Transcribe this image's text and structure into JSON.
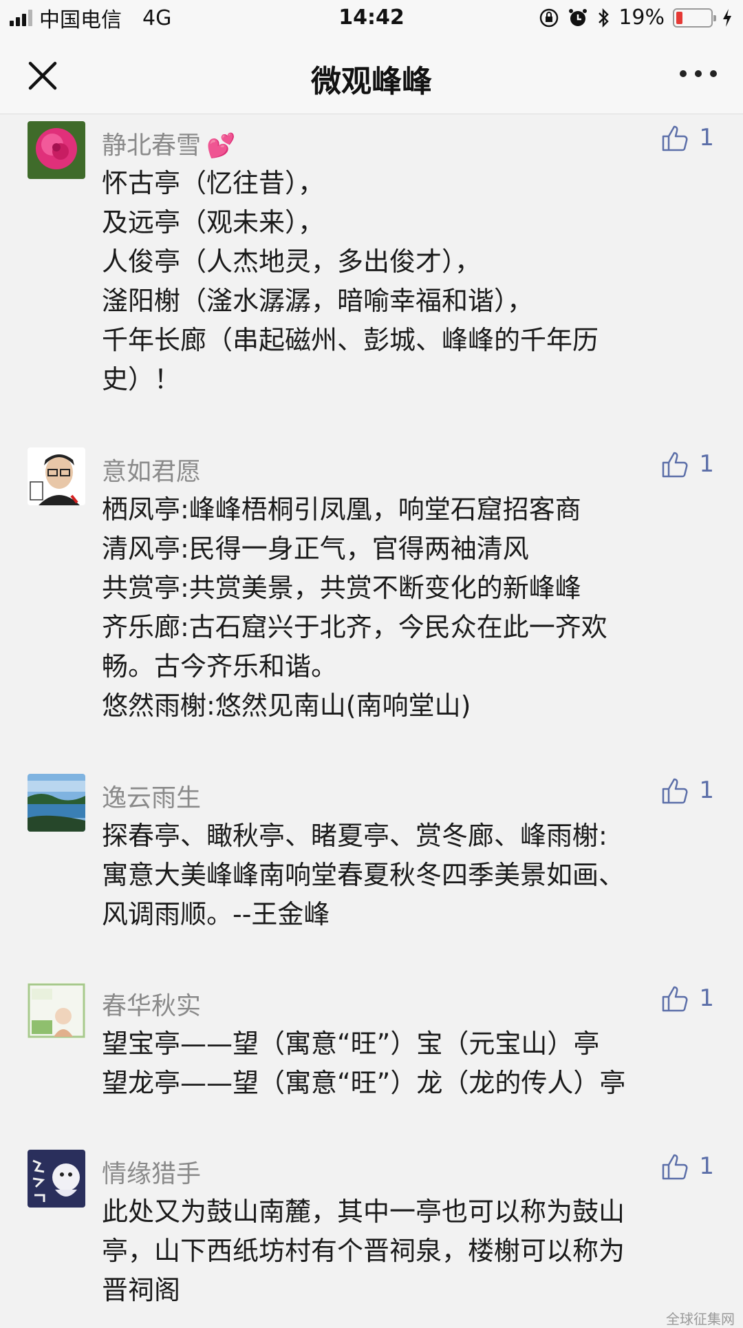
{
  "status_bar": {
    "carrier": "中国电信",
    "network": "4G",
    "time": "14:42",
    "battery_percent_text": "19%",
    "battery_level": 0.19
  },
  "nav": {
    "title": "微观峰峰"
  },
  "comments": [
    {
      "nickname": "静北春雪",
      "likes": "1",
      "lines": [
        "怀古亭（忆往昔），",
        "及远亭（观未来），",
        "人俊亭（人杰地灵，多出俊才），",
        "滏阳榭（滏水潺潺，暗喻幸福和谐），",
        "千年长廊（串起磁州、彭城、峰峰的千年历",
        "史）！"
      ]
    },
    {
      "nickname": "意如君愿",
      "likes": "1",
      "lines": [
        "栖凤亭:峰峰梧桐引凤凰，响堂石窟招客商",
        "清风亭:民得一身正气，官得两袖清风",
        "共赏亭:共赏美景，共赏不断变化的新峰峰",
        "齐乐廊:古石窟兴于北齐，今民众在此一齐欢",
        "畅。古今齐乐和谐。",
        "悠然雨榭:悠然见南山(南响堂山)"
      ]
    },
    {
      "nickname": "逸云雨生",
      "likes": "1",
      "lines": [
        "探春亭、瞰秋亭、睹夏亭、赏冬廊、峰雨榭:",
        "寓意大美峰峰南响堂春夏秋冬四季美景如画、",
        "风调雨顺。--王金峰"
      ]
    },
    {
      "nickname": "春华秋实",
      "likes": "1",
      "lines": [
        "望宝亭——望（寓意“旺”）宝（元宝山）亭",
        "望龙亭——望（寓意“旺”）龙（龙的传人）亭"
      ]
    },
    {
      "nickname": "情缘猎手",
      "likes": "1",
      "lines": [
        "此处又为鼓山南麓，其中一亭也可以称为鼓山",
        "亭，山下西纸坊村有个晋祠泉，楼榭可以称为",
        "晋祠阁"
      ]
    }
  ],
  "watermark": "全球征集网",
  "icons": {
    "close": "close-icon",
    "more": "more-icon",
    "like": "thumbs-up-icon",
    "heart": "two-hearts-icon"
  },
  "colors": {
    "like_blue": "#5b6ea8",
    "nickname_gray": "#8a8a8a",
    "battery_red": "#e53935"
  }
}
